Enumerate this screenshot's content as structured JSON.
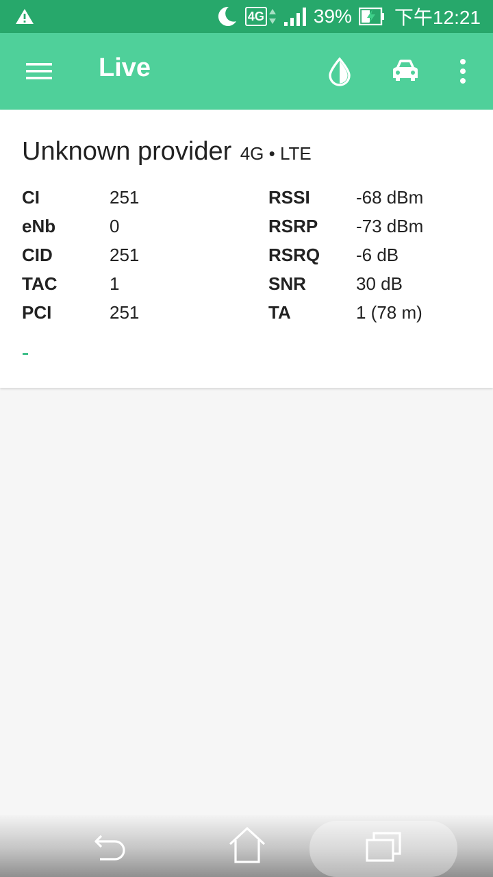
{
  "status_bar": {
    "warning_icon": "warning-triangle-icon",
    "dnd_icon": "moon-icon",
    "network_type": "4G",
    "signal_icon": "signal-bars-icon",
    "battery_percent": "39%",
    "battery_icon": "battery-charging-icon",
    "time": "下午12:21",
    "background_color": "#27a86b"
  },
  "app_bar": {
    "title": "Live",
    "menu_icon": "hamburger-menu-icon",
    "actions": [
      "drop-icon",
      "car-icon",
      "more-vertical-icon"
    ],
    "background_color": "#4fd09a"
  },
  "cell_info": {
    "provider": "Unknown provider",
    "technology": "4G • LTE",
    "left_rows": [
      {
        "label": "CI",
        "value": "251"
      },
      {
        "label": "eNb",
        "value": "0"
      },
      {
        "label": "CID",
        "value": "251"
      },
      {
        "label": "TAC",
        "value": "1"
      },
      {
        "label": "PCI",
        "value": "251"
      }
    ],
    "right_rows": [
      {
        "label": "RSSI",
        "value": "-68 dBm"
      },
      {
        "label": "RSRP",
        "value": "-73 dBm"
      },
      {
        "label": "RSRQ",
        "value": "-6 dB"
      },
      {
        "label": "SNR",
        "value": "30 dB"
      },
      {
        "label": "TA",
        "value": "1 (78 m)"
      }
    ],
    "footer_text": "-"
  },
  "nav_bar": {
    "buttons": [
      "back-icon",
      "home-icon",
      "recent-apps-icon"
    ]
  }
}
